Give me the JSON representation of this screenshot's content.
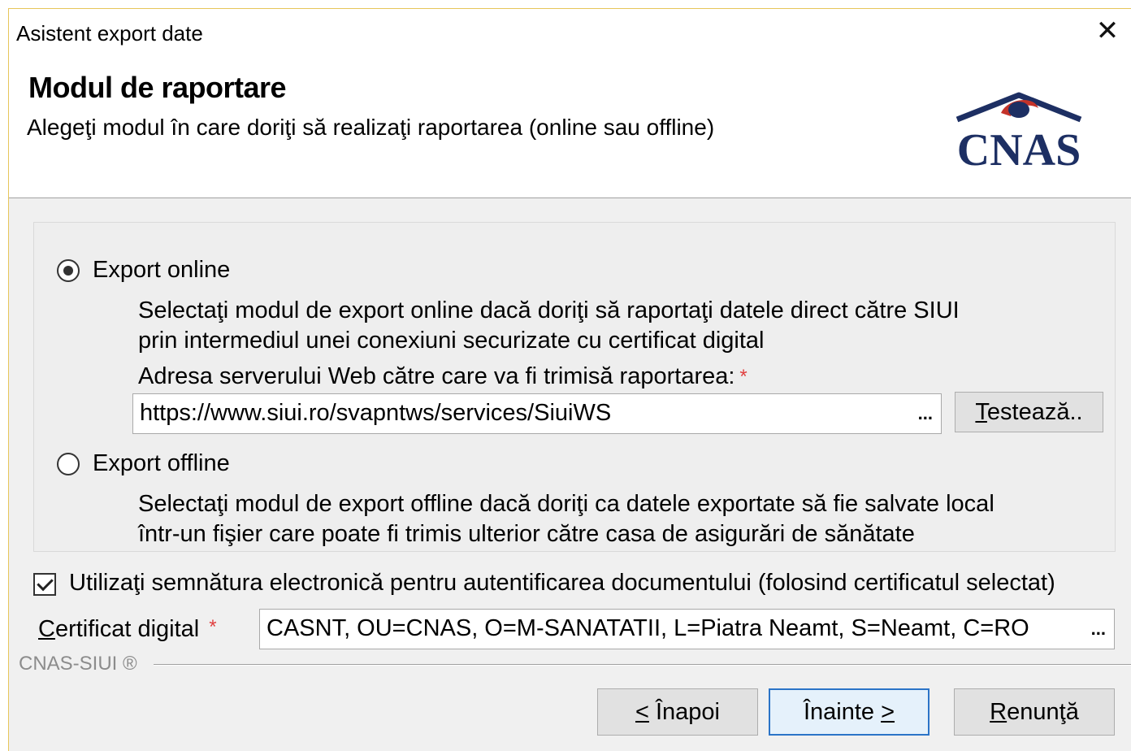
{
  "window": {
    "title": "Asistent export date",
    "close_glyph": "✕"
  },
  "header": {
    "heading": "Modul de raportare",
    "subtitle": "Alegeţi modul în care doriţi să realizaţi raportarea (online sau offline)",
    "logo_text": "CNAS",
    "colors": {
      "logo_navy": "#1d2f63",
      "logo_red": "#c4332a"
    }
  },
  "export_online": {
    "label": "Export online",
    "selected": true,
    "desc_line1": "Selectaţi modul de export online dacă doriţi să raportaţi datele direct către SIUI",
    "desc_line2": "prin intermediul unei conexiuni securizate cu certificat digital",
    "server_label": "Adresa serverului Web către care va fi trimisă raportarea:",
    "required_mark": "*",
    "server_url": "https://www.siui.ro/svapntws/services/SiuiWS",
    "browse_glyph": "...",
    "test_button_prefix": "T",
    "test_button_rest": "estează.."
  },
  "export_offline": {
    "label": "Export offline",
    "selected": false,
    "desc_line1": "Selectaţi modul de export offline dacă doriţi ca datele exportate să fie salvate local",
    "desc_line2": "într-un fişier care poate fi trimis ulterior către casa de asigurări de sănătate"
  },
  "signature": {
    "checked": true,
    "label": "Utilizaţi semnătura electronică pentru autentificarea documentului (folosind certificatul selectat)"
  },
  "certificate": {
    "label_prefix": "C",
    "label_rest": "ertificat digital",
    "required_mark": "*",
    "value": "CASNT, OU=CNAS, O=M-SANATATII, L=Piatra Neamt, S=Neamt, C=RO",
    "browse_glyph": "..."
  },
  "footer": {
    "brand": "CNAS-SIUI ®"
  },
  "buttons": {
    "back_prefix": "<",
    "back_rest": " Înapoi",
    "next_main": "Înainte ",
    "next_suffix": ">",
    "cancel_prefix": "R",
    "cancel_rest": "enunţă"
  }
}
